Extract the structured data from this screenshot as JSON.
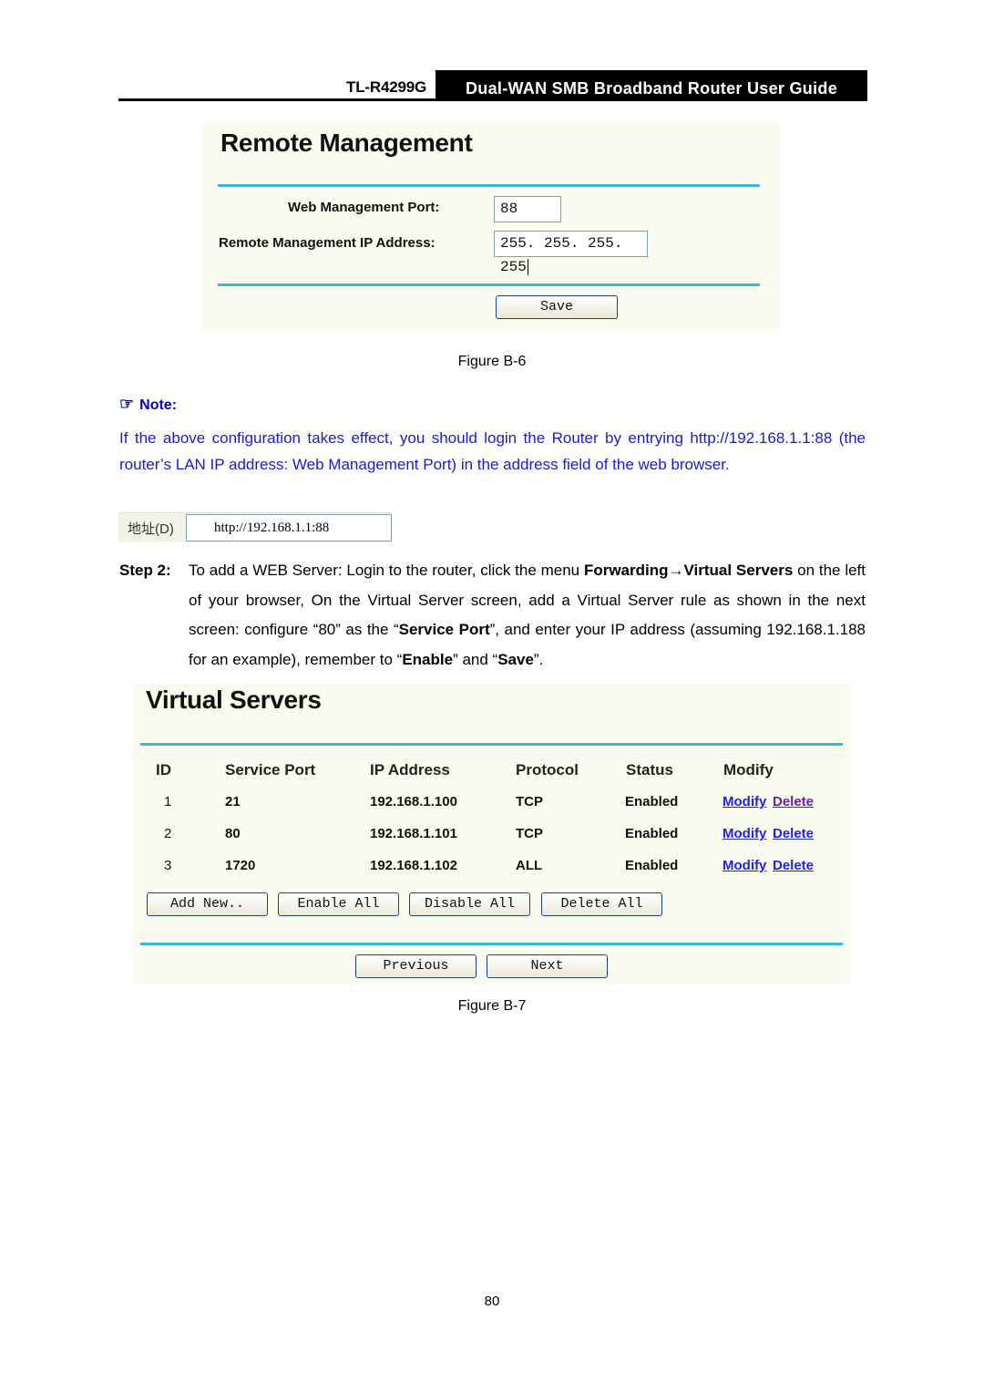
{
  "header": {
    "model": "TL-R4299G",
    "title": "Dual-WAN SMB Broadband Router User Guide"
  },
  "figure_b6": {
    "title": "Remote Management",
    "fields": [
      {
        "label": "Web Management Port:",
        "value": "88"
      },
      {
        "label": "Remote Management IP Address:",
        "value": "255. 255. 255. 255"
      }
    ],
    "save_label": "Save",
    "caption": "Figure B-6"
  },
  "note": {
    "icon": "pointing-hand-icon",
    "heading": "Note:",
    "text": "If the above configuration takes effect, you should login the Router by entrying http://192.168.1.1:88 (the router’s LAN IP address: Web Management Port) in the address field of the web browser."
  },
  "address_bar": {
    "label": "地址(D)",
    "url": "http://192.168.1.1:88"
  },
  "step2": {
    "label": "Step 2:",
    "parts": [
      {
        "text": "To add a WEB Server: Login to the router, click the menu ",
        "bold": false
      },
      {
        "text": "Forwarding→Virtual Servers",
        "bold": true
      },
      {
        "text": " on the left of your browser, On the Virtual Server screen, add a Virtual Server rule as shown in the next screen: configure “80” as the “",
        "bold": false
      },
      {
        "text": "Service Port",
        "bold": true
      },
      {
        "text": "”, and enter your IP address (assuming 192.168.1.188 for an example), remember to “",
        "bold": false
      },
      {
        "text": "Enable",
        "bold": true
      },
      {
        "text": "” and “",
        "bold": false
      },
      {
        "text": "Save",
        "bold": true
      },
      {
        "text": "”.",
        "bold": false
      }
    ]
  },
  "figure_b7": {
    "title": "Virtual Servers",
    "columns": [
      "ID",
      "Service Port",
      "IP Address",
      "Protocol",
      "Status",
      "Modify"
    ],
    "rows": [
      {
        "id": "1",
        "port": "21",
        "ip": "192.168.1.100",
        "protocol": "TCP",
        "status": "Enabled",
        "modify": "Modify",
        "delete": "Delete"
      },
      {
        "id": "2",
        "port": "80",
        "ip": "192.168.1.101",
        "protocol": "TCP",
        "status": "Enabled",
        "modify": "Modify",
        "delete": "Delete"
      },
      {
        "id": "3",
        "port": "1720",
        "ip": "192.168.1.102",
        "protocol": "ALL",
        "status": "Enabled",
        "modify": "Modify",
        "delete": "Delete"
      }
    ],
    "buttons": [
      "Add New..",
      "Enable All",
      "Disable All",
      "Delete All"
    ],
    "nav": {
      "previous": "Previous",
      "next": "Next"
    },
    "caption": "Figure B-7"
  },
  "page_number": "80",
  "colors": {
    "accent_rule": "#3ab8d8",
    "note_text": "#1a1ad6",
    "link": "#2020ee",
    "link_visited": "#6a1ab8",
    "panel_bg": "#fbfcf0"
  }
}
